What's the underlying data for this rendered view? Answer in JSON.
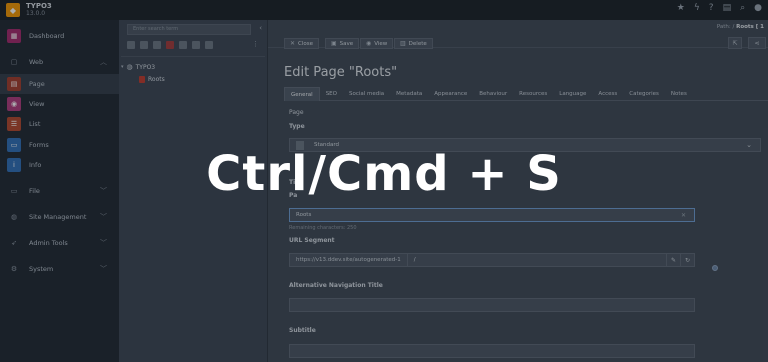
{
  "app": {
    "name": "TYPO3",
    "version": "13.0.0"
  },
  "topbar_icons": [
    "star-icon",
    "bolt-icon",
    "help-icon",
    "list-icon",
    "search-icon",
    "user-icon"
  ],
  "modules": {
    "dashboard": "Dashboard",
    "web": "Web",
    "page": "Page",
    "view": "View",
    "list": "List",
    "forms": "Forms",
    "info": "Info",
    "file": "File",
    "site_management": "Site Management",
    "admin_tools": "Admin Tools",
    "system": "System"
  },
  "colors": {
    "dashboard": "#a4276a",
    "page": "#a33b2a",
    "view": "#b03a7c",
    "list": "#b3462b",
    "forms": "#2f6db5",
    "info": "#2f6db5"
  },
  "tree": {
    "search_placeholder": "Enter search term",
    "root": "TYPO3",
    "child": "Roots"
  },
  "docheader": {
    "close": "Close",
    "save": "Save",
    "view": "View",
    "delete": "Delete",
    "path_label": "Path: /",
    "path_value": "Roots [ 1"
  },
  "form": {
    "title": "Edit Page \"Roots\"",
    "tabs": [
      "General",
      "SEO",
      "Social media",
      "Metadata",
      "Appearance",
      "Behaviour",
      "Resources",
      "Language",
      "Access",
      "Categories",
      "Notes"
    ],
    "section": "Page",
    "type_label": "Type",
    "type_value": "Standard",
    "title_label_partial": "Ti",
    "page_title_label_partial": "Pa",
    "page_title_value": "Roots",
    "remaining": "Remaining characters: 250",
    "url_label": "URL Segment",
    "url_prefix": "https://v13.ddev.site/autogenerated-1",
    "url_value": "/",
    "nav_title_label": "Alternative Navigation Title",
    "nav_title_value": "",
    "subtitle_label": "Subtitle",
    "subtitle_value": ""
  },
  "overlay": {
    "shortcut": "Ctrl/Cmd + S"
  }
}
